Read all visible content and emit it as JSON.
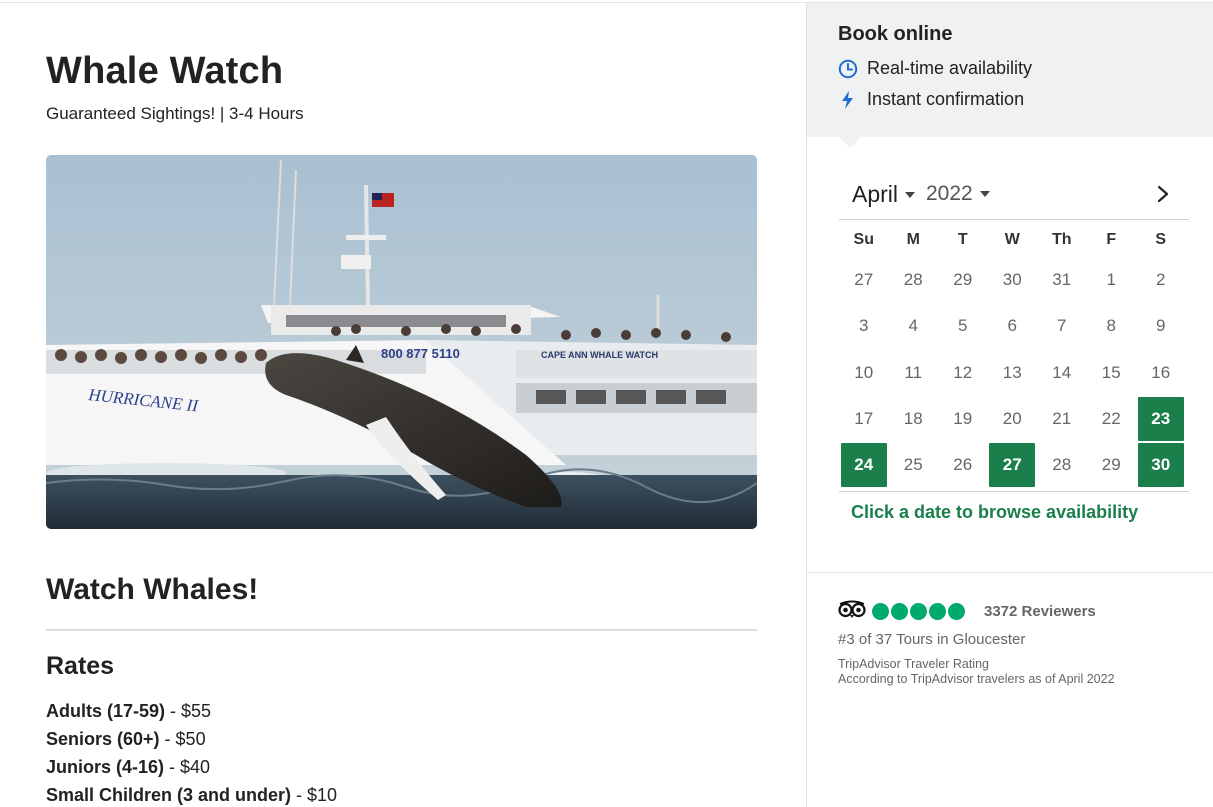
{
  "tour": {
    "title": "Whale Watch",
    "subtitle": "Guaranteed Sightings! | 3-4 Hours",
    "section_heading": "Watch Whales!",
    "rates_heading": "Rates",
    "rates": [
      {
        "label": "Adults (17-59)",
        "price": " - $55"
      },
      {
        "label": "Seniors (60+)",
        "price": " - $50"
      },
      {
        "label": "Juniors (4-16)",
        "price": " - $40"
      },
      {
        "label": "Small Children (3 and under)",
        "price": " - $10"
      }
    ],
    "hero_image": {
      "description": "humpback-whale-breaching-next-to-boat",
      "boat_name": "HURRICANE II",
      "boat_sign": "CAPE ANN WHALE WATCH",
      "boat_phone": "800 877 5110"
    }
  },
  "booking": {
    "title": "Book online",
    "features": [
      {
        "icon": "clock-icon",
        "label": "Real-time availability"
      },
      {
        "icon": "lightning-bolt-icon",
        "label": "Instant confirmation"
      }
    ],
    "calendar": {
      "month": "April",
      "year": "2022",
      "weekdays": [
        "Su",
        "M",
        "T",
        "W",
        "Th",
        "F",
        "S"
      ],
      "weeks": [
        [
          "27",
          "28",
          "29",
          "30",
          "31",
          "1",
          "2"
        ],
        [
          "3",
          "4",
          "5",
          "6",
          "7",
          "8",
          "9"
        ],
        [
          "10",
          "11",
          "12",
          "13",
          "14",
          "15",
          "16"
        ],
        [
          "17",
          "18",
          "19",
          "20",
          "21",
          "22",
          "23"
        ],
        [
          "24",
          "25",
          "26",
          "27",
          "28",
          "29",
          "30"
        ]
      ],
      "available_days": [
        "23",
        "24",
        "27",
        "30"
      ],
      "available_color": "#1a7f4b",
      "cta": "Click a date to browse availability"
    }
  },
  "tripadvisor": {
    "rating_bubbles": 5,
    "bubble_color": "#00aa6c",
    "reviewers": "3372 Reviewers",
    "rank": "#3 of 37 Tours in Gloucester",
    "rating_label": "TripAdvisor Traveler Rating",
    "note": "According to TripAdvisor travelers as of April 2022"
  }
}
